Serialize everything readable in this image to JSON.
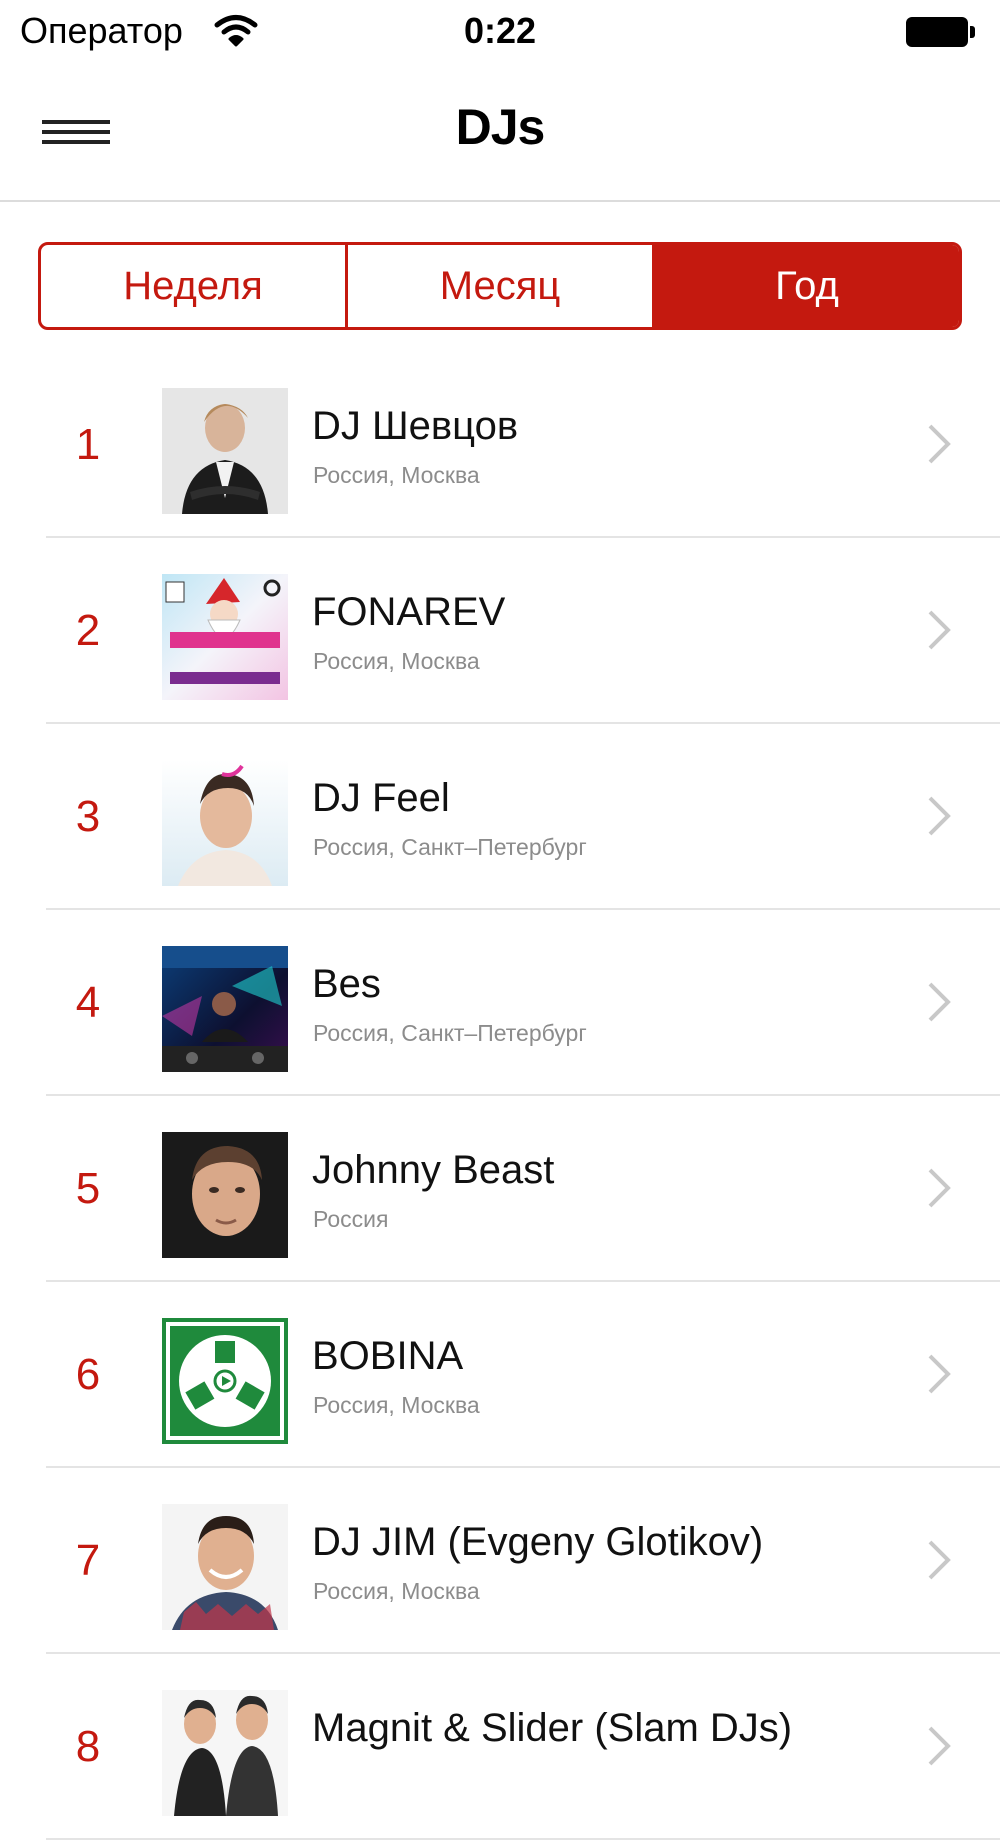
{
  "status_bar": {
    "carrier": "Оператор",
    "time": "0:22"
  },
  "nav": {
    "title": "DJs"
  },
  "segments": [
    {
      "label": "Неделя",
      "selected": false
    },
    {
      "label": "Месяц",
      "selected": false
    },
    {
      "label": "Год",
      "selected": true
    }
  ],
  "djs": [
    {
      "rank": "1",
      "name": "DJ Шевцов",
      "location": "Россия, Москва"
    },
    {
      "rank": "2",
      "name": "FONAREV",
      "location": "Россия, Москва"
    },
    {
      "rank": "3",
      "name": "DJ Feel",
      "location": "Россия, Санкт–Петербург"
    },
    {
      "rank": "4",
      "name": "Bes",
      "location": "Россия, Санкт–Петербург"
    },
    {
      "rank": "5",
      "name": "Johnny Beast",
      "location": "Россия"
    },
    {
      "rank": "6",
      "name": "BOBINA",
      "location": "Россия, Москва"
    },
    {
      "rank": "7",
      "name": "DJ JIM (Evgeny Glotikov)",
      "location": "Россия, Москва"
    },
    {
      "rank": "8",
      "name": "Magnit & Slider (Slam DJs)",
      "location": ""
    }
  ],
  "colors": {
    "accent": "#c4190f",
    "divider": "#e4e4e4",
    "secondary_text": "#8c8c8c"
  },
  "icons": {
    "menu": "hamburger-menu-icon",
    "wifi": "wifi-icon",
    "battery": "battery-icon",
    "row_disclosure": "chevron-right-icon"
  }
}
